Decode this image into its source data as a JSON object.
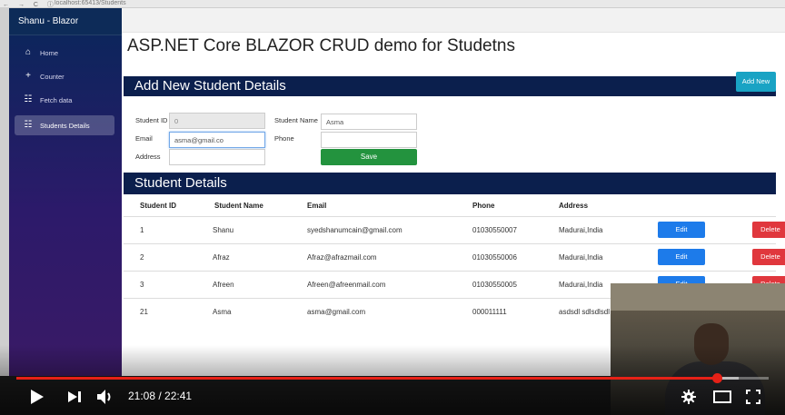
{
  "browser": {
    "nav_glyphs": "← → C ⓘ",
    "url": "localhost:65413/Students"
  },
  "sidebar": {
    "brand": "Shanu - Blazor",
    "items": [
      {
        "label": "Home",
        "icon": "home-icon",
        "glyph": "⌂"
      },
      {
        "label": "Counter",
        "icon": "plus-icon",
        "glyph": "+"
      },
      {
        "label": "Fetch data",
        "icon": "list-icon",
        "glyph": "☷"
      },
      {
        "label": "Students Details",
        "icon": "list-icon",
        "glyph": "☷",
        "active": true
      }
    ]
  },
  "page": {
    "title": "ASP.NET Core BLAZOR CRUD demo for Studetns",
    "add_section_title": "Add New Student Details",
    "add_new_button": "Add New",
    "list_section_title": "Student Details"
  },
  "form": {
    "student_id_label": "Student ID",
    "student_id_value": "0",
    "student_name_label": "Student Name",
    "student_name_value": "Asma",
    "email_label": "Email",
    "email_value": "asma@gmail.co",
    "phone_label": "Phone",
    "phone_value": "",
    "address_label": "Address",
    "address_value": "",
    "save_button": "Save"
  },
  "table": {
    "headers": [
      "Student ID",
      "Student Name",
      "Email",
      "Phone",
      "Address"
    ],
    "edit_label": "Edit",
    "delete_label": "Delete",
    "rows": [
      {
        "id": "1",
        "name": "Shanu",
        "email": "syedshanumcain@gmail.com",
        "phone": "01030550007",
        "address": "Madurai,India"
      },
      {
        "id": "2",
        "name": "Afraz",
        "email": "Afraz@afrazmail.com",
        "phone": "01030550006",
        "address": "Madurai,India"
      },
      {
        "id": "3",
        "name": "Afreen",
        "email": "Afreen@afreenmail.com",
        "phone": "01030550005",
        "address": "Madurai,India"
      },
      {
        "id": "21",
        "name": "Asma",
        "email": "asma@gmail.com",
        "phone": "000011111",
        "address": "asdsdl sdlsdlsdl"
      }
    ]
  },
  "player": {
    "current_time": "21:08",
    "total_time": "22:41",
    "time_display": "21:08 / 22:41",
    "progress_fraction": 0.931,
    "buffered_fraction": 0.96,
    "colors": {
      "progress": "#e62117"
    }
  }
}
